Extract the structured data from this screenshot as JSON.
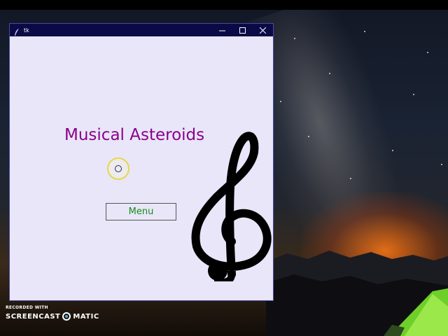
{
  "window": {
    "title": "tk",
    "controls": {
      "minimize": "minimize",
      "maximize": "maximize",
      "close": "close"
    }
  },
  "app": {
    "title": "Musical Asteroids",
    "menu_button_label": "Menu",
    "colors": {
      "title": "#8b008b",
      "button_text": "#1a8a1a",
      "background": "#e8e6f8"
    },
    "image": "treble-clef-icon"
  },
  "watermark": {
    "line1": "RECORDED WITH",
    "line2_left": "SCREENCAST",
    "line2_right": "MATIC"
  }
}
